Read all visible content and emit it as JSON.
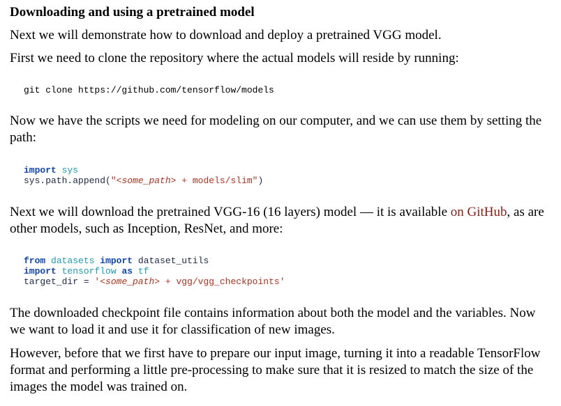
{
  "heading": "Downloading and using a pretrained model",
  "p1": "Next we will demonstrate how to download and deploy a pretrained VGG model.",
  "p2": "First we need to clone the repository where the actual models will reside by running:",
  "code1": "git clone https://github.com/tensorflow/models",
  "p3": "Now we have the scripts we need for modeling on our computer, and we can use them by setting the path:",
  "code2": {
    "line1_kw": "import",
    "line1_mod": "sys",
    "line2_pre": "sys.path.append(",
    "line2_str_open": "\"",
    "line2_str_path": "<some_path>",
    "line2_str_rest": " + models/slim\"",
    "line2_post": ")"
  },
  "p4": {
    "before": "Next we will download the pretrained VGG-16 (16 layers) model — it is available ",
    "link": "on GitHub",
    "after": ", as are other models, such as Inception, ResNet, and more:"
  },
  "code3": {
    "l1_kw1": "from",
    "l1_mod": "datasets",
    "l1_kw2": "import",
    "l1_name": "dataset_utils",
    "l2_kw1": "import",
    "l2_mod": "tensorflow",
    "l2_kw2": "as",
    "l2_alias": "tf",
    "l3_var": "target_dir = ",
    "l3_str_open": "'",
    "l3_str_path": "<some_path>",
    "l3_str_rest": " + vgg/vgg_checkpoints'"
  },
  "p5": "The downloaded checkpoint file contains information about both the model and the variables. Now we want to load it and use it for classification of new images.",
  "p6": "However, before that we first have to prepare our input image, turning it into a readable TensorFlow format and performing a little pre-processing to make sure that it is resized to match the size of the images the model was trained on."
}
